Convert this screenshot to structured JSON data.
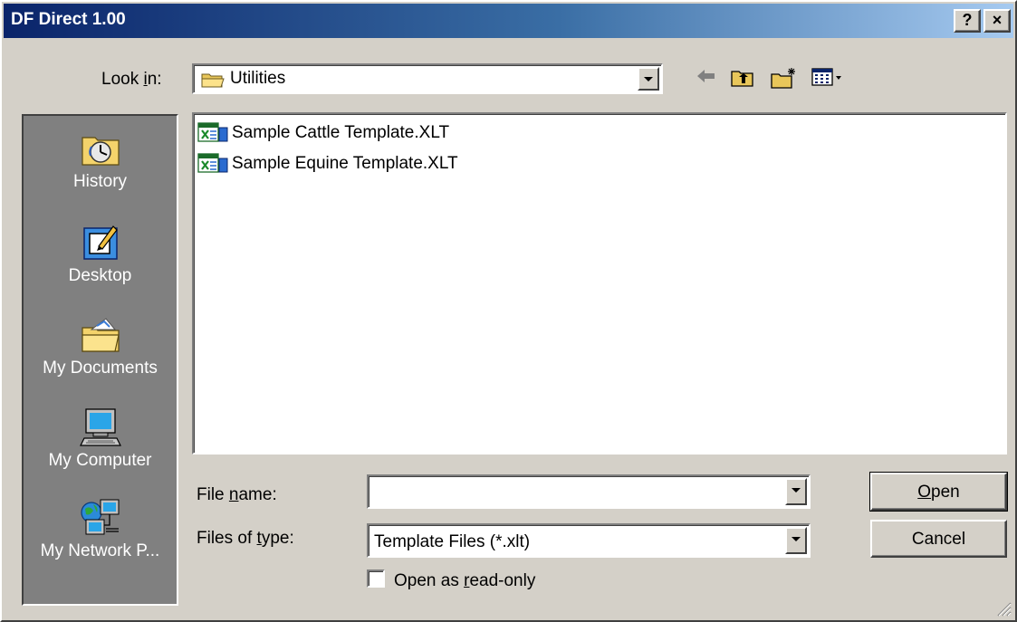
{
  "window": {
    "title": "DF Direct 1.00",
    "help_button": "?",
    "close_button": "×"
  },
  "look_in": {
    "label_pre": "Look ",
    "label_key": "i",
    "label_post": "n:",
    "value": "Utilities"
  },
  "places": [
    {
      "label": "History",
      "icon": "history-icon"
    },
    {
      "label": "Desktop",
      "icon": "desktop-icon"
    },
    {
      "label": "My Documents",
      "icon": "my-documents-icon"
    },
    {
      "label": "My Computer",
      "icon": "my-computer-icon"
    },
    {
      "label": "My Network P...",
      "icon": "my-network-places-icon"
    }
  ],
  "files": [
    {
      "name": "Sample Cattle Template.XLT",
      "icon": "excel-template-icon"
    },
    {
      "name": "Sample Equine Template.XLT",
      "icon": "excel-template-icon"
    }
  ],
  "file_name": {
    "label_pre": "File ",
    "label_key": "n",
    "label_post": "ame:",
    "value": ""
  },
  "file_type": {
    "label_pre": "Files of ",
    "label_key": "t",
    "label_post": "ype:",
    "value": "Template Files (*.xlt)"
  },
  "read_only": {
    "label_pre": "Open as ",
    "label_key": "r",
    "label_post": "ead-only",
    "checked": false
  },
  "buttons": {
    "open_key": "O",
    "open_rest": "pen",
    "cancel": "Cancel"
  }
}
